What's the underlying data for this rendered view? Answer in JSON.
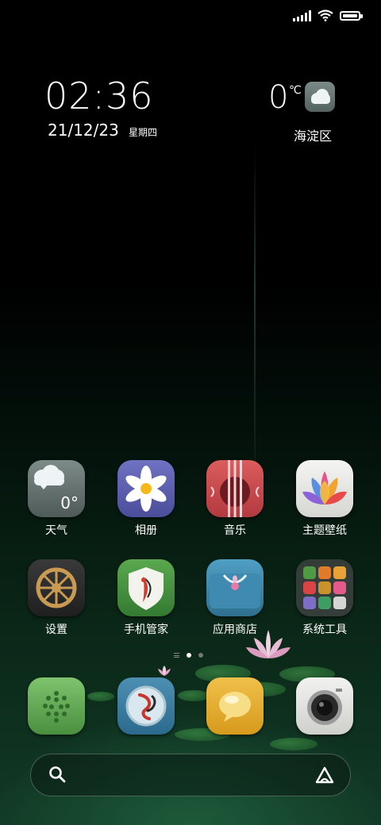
{
  "status_bar": {
    "signal_bars": 5,
    "battery_level": 0.95
  },
  "clock_widget": {
    "time": "02:36",
    "date": "21/12/23",
    "weekday": "星期四",
    "temperature": "0",
    "temperature_unit": "℃",
    "location": "海淀区",
    "weather_icon": "cloud-icon"
  },
  "apps": [
    {
      "label": "天气",
      "icon": "weather-icon",
      "badge_text": "0°"
    },
    {
      "label": "相册",
      "icon": "gallery-icon"
    },
    {
      "label": "音乐",
      "icon": "music-icon"
    },
    {
      "label": "主题壁纸",
      "icon": "themes-icon"
    },
    {
      "label": "设置",
      "icon": "settings-icon"
    },
    {
      "label": "手机管家",
      "icon": "security-icon"
    },
    {
      "label": "应用商店",
      "icon": "app-store-icon"
    },
    {
      "label": "系统工具",
      "icon": "tools-folder-icon"
    }
  ],
  "page_indicator": {
    "pages": 2,
    "current": 1
  },
  "dock": [
    {
      "icon": "phone-icon"
    },
    {
      "icon": "browser-icon"
    },
    {
      "icon": "messaging-icon"
    },
    {
      "icon": "camera-icon"
    }
  ],
  "search_bar": {
    "left_icon": "search-icon",
    "right_icon": "assistant-icon"
  },
  "colors": {
    "background_top": "#000000",
    "background_bottom": "#123a26"
  }
}
